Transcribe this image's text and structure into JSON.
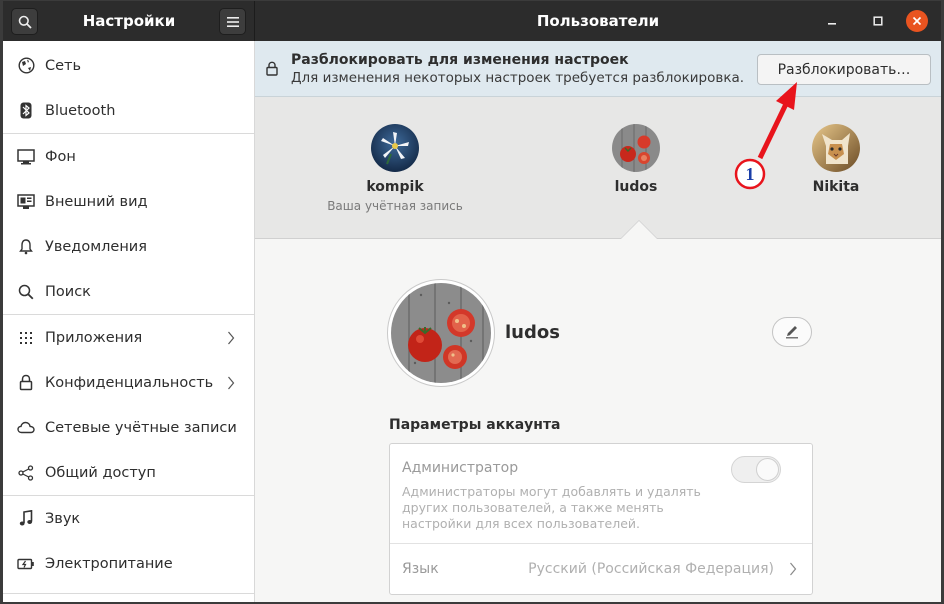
{
  "window": {
    "sidebar_title": "Настройки",
    "main_title": "Пользователи",
    "search_icon": "search-icon",
    "menu_icon": "hamburger-menu-icon",
    "minimize_icon": "minimize-icon",
    "maximize_icon": "maximize-icon",
    "close_icon": "close-icon",
    "accent_close": "#e95420"
  },
  "sidebar": {
    "items": [
      {
        "label": "Сеть",
        "icon": "network-icon"
      },
      {
        "label": "Bluetooth",
        "icon": "bluetooth-icon"
      },
      {
        "label": "Фон",
        "icon": "background-icon"
      },
      {
        "label": "Внешний вид",
        "icon": "appearance-icon"
      },
      {
        "label": "Уведомления",
        "icon": "bell-icon"
      },
      {
        "label": "Поиск",
        "icon": "search-icon"
      },
      {
        "label": "Приложения",
        "icon": "apps-grid-icon"
      },
      {
        "label": "Конфиденциальность",
        "icon": "lock-icon"
      },
      {
        "label": "Сетевые учётные записи",
        "icon": "cloud-icon"
      },
      {
        "label": "Общий доступ",
        "icon": "share-icon"
      },
      {
        "label": "Звук",
        "icon": "music-note-icon"
      },
      {
        "label": "Электропитание",
        "icon": "power-icon"
      }
    ]
  },
  "infobar": {
    "title": "Разблокировать для изменения настроек",
    "subtitle": "Для изменения некоторых настроек требуется разблокировка.",
    "button": "Разблокировать…",
    "icon": "lock-icon"
  },
  "users": [
    {
      "name": "kompik",
      "subtitle": "Ваша учётная запись"
    },
    {
      "name": "ludos",
      "subtitle": ""
    },
    {
      "name": "Nikita",
      "subtitle": ""
    }
  ],
  "selected_user": {
    "name": "ludos",
    "edit_icon": "pencil-icon"
  },
  "account": {
    "section_title": "Параметры аккаунта",
    "admin_label": "Администратор",
    "admin_description": "Администраторы могут добавлять и удалять других пользователей, а также менять настройки для всех пользователей.",
    "admin_enabled": false,
    "language_label": "Язык",
    "language_value": "Русский (Российская Федерация)"
  },
  "annotation": {
    "marker": "1",
    "color": "#e8141c"
  }
}
